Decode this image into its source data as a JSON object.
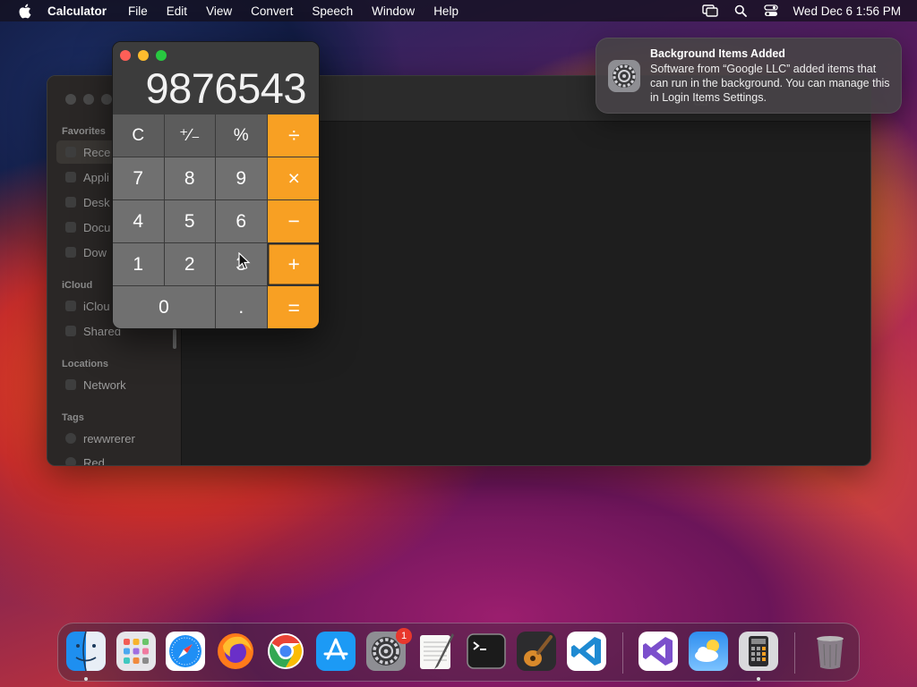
{
  "menubar": {
    "app": "Calculator",
    "items": [
      "File",
      "Edit",
      "View",
      "Convert",
      "Speech",
      "Window",
      "Help"
    ],
    "clock": "Wed Dec 6  1:56 PM"
  },
  "finder": {
    "sections": {
      "favorites": "Favorites",
      "icloud": "iCloud",
      "locations": "Locations",
      "tags": "Tags"
    },
    "favorites": [
      "Rece",
      "Appli",
      "Desk",
      "Docu",
      "Dow"
    ],
    "icloud": [
      "iClou",
      "Shared"
    ],
    "locations": [
      "Network"
    ],
    "tags": [
      "rewwrerer",
      "Red"
    ]
  },
  "calculator": {
    "display": "9876543",
    "keys": {
      "clear": "C",
      "sign": "⁺∕₋",
      "percent": "%",
      "divide": "÷",
      "seven": "7",
      "eight": "8",
      "nine": "9",
      "multiply": "×",
      "four": "4",
      "five": "5",
      "six": "6",
      "minus": "−",
      "one": "1",
      "two": "2",
      "three": "3",
      "plus": "+",
      "zero": "0",
      "decimal": ".",
      "equals": "="
    },
    "colors": {
      "operator": "#f8a023",
      "digit": "#707070",
      "function": "#5c5c5c"
    }
  },
  "notification": {
    "title": "Background Items Added",
    "body": "Software from “Google LLC” added items that can run in the background. You can manage this in Login Items Settings."
  },
  "dock": {
    "apps": [
      "finder-icon",
      "launchpad-icon",
      "safari-icon",
      "firefox-icon",
      "chrome-icon",
      "app-store-icon",
      "system-settings-icon",
      "textedit-icon",
      "terminal-icon",
      "garageband-icon",
      "vscode-icon",
      "visual-studio-icon",
      "weather-icon",
      "calculator-icon",
      "trash-icon"
    ],
    "settings_badge": "1"
  }
}
